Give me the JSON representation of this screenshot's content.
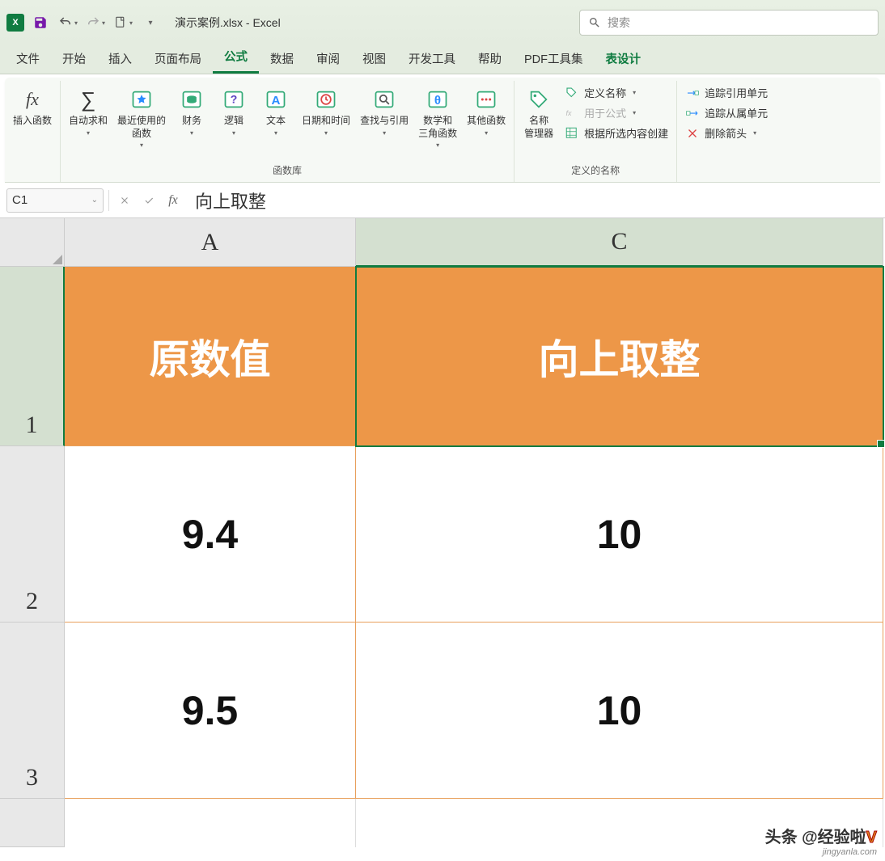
{
  "title": "演示案例.xlsx - Excel",
  "search_placeholder": "搜索",
  "tabs": [
    "文件",
    "开始",
    "插入",
    "页面布局",
    "公式",
    "数据",
    "审阅",
    "视图",
    "开发工具",
    "帮助",
    "PDF工具集",
    "表设计"
  ],
  "active_tab": "公式",
  "ribbon": {
    "insert_function": "插入函数",
    "autosum": "自动求和",
    "recent": "最近使用的\n函数",
    "financial": "财务",
    "logical": "逻辑",
    "text": "文本",
    "datetime": "日期和时间",
    "lookup": "查找与引用",
    "math": "数学和\n三角函数",
    "more": "其他函数",
    "lib_label": "函数库",
    "name_manager": "名称\n管理器",
    "define_name": "定义名称",
    "use_in_formula": "用于公式",
    "create_from_selection": "根据所选内容创建",
    "names_label": "定义的名称",
    "trace_precedents": "追踪引用单元",
    "trace_dependents": "追踪从属单元",
    "remove_arrows": "删除箭头"
  },
  "name_box": "C1",
  "formula_value": "向上取整",
  "columns": {
    "a": "A",
    "c": "C"
  },
  "rows": [
    "1",
    "2",
    "3"
  ],
  "cells": {
    "a1": "原数值",
    "c1": "向上取整",
    "a2": "9.4",
    "c2": "10",
    "a3": "9.5",
    "c3": "10"
  },
  "watermark": {
    "line1_a": "头条",
    "line1_b": "@经验啦",
    "line1_c": "V",
    "line2": "jingyanla.com"
  },
  "chart_data": {
    "type": "table",
    "title": "向上取整",
    "columns": [
      "原数值",
      "向上取整"
    ],
    "rows": [
      [
        9.4,
        10
      ],
      [
        9.5,
        10
      ]
    ]
  }
}
